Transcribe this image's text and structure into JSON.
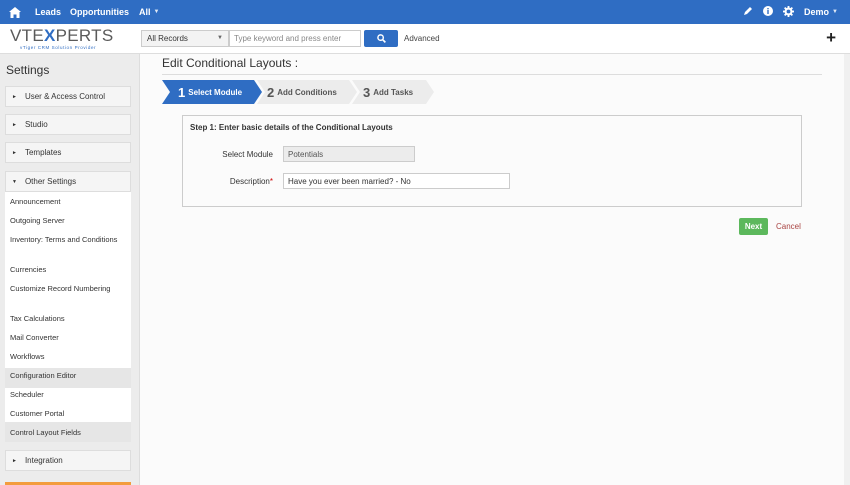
{
  "topbar": {
    "nav": [
      "Leads",
      "Opportunities",
      "All"
    ],
    "user": "Demo"
  },
  "logo": {
    "brand_pre": "VTE",
    "brand_x": "X",
    "brand_post": "PERTS",
    "tagline": "vTiger CRM Solution Provider"
  },
  "search": {
    "records_select": "All Records",
    "keyword_placeholder": "Type keyword and press enter",
    "advanced_label": "Advanced"
  },
  "sidebar": {
    "title": "Settings",
    "sections": [
      "User & Access Control",
      "Studio",
      "Templates",
      "Other Settings",
      "Integration"
    ],
    "other_items": [
      "Announcement",
      "Outgoing Server",
      "Inventory: Terms and Conditions",
      "Currencies",
      "Customize Record Numbering",
      "Tax Calculations",
      "Mail Converter",
      "Workflows",
      "Configuration Editor",
      "Scheduler",
      "Customer Portal",
      "Control Layout Fields"
    ]
  },
  "main": {
    "title": "Edit Conditional Layouts :",
    "steps": [
      {
        "num": "1",
        "label": "Select Module"
      },
      {
        "num": "2",
        "label": "Add Conditions"
      },
      {
        "num": "3",
        "label": "Add Tasks"
      }
    ],
    "box_heading": "Step 1: Enter basic details of the Conditional Layouts",
    "module_label": "Select Module",
    "module_value": "Potentials",
    "desc_label": "Description",
    "desc_required": "*",
    "desc_value": "Have you ever been married? - No",
    "next_label": "Next",
    "cancel_label": "Cancel"
  },
  "colors": {
    "brand": "#2f6dc3",
    "active_step": "#2f6dc3",
    "next": "#5cb85c",
    "cancel": "#a94442"
  }
}
